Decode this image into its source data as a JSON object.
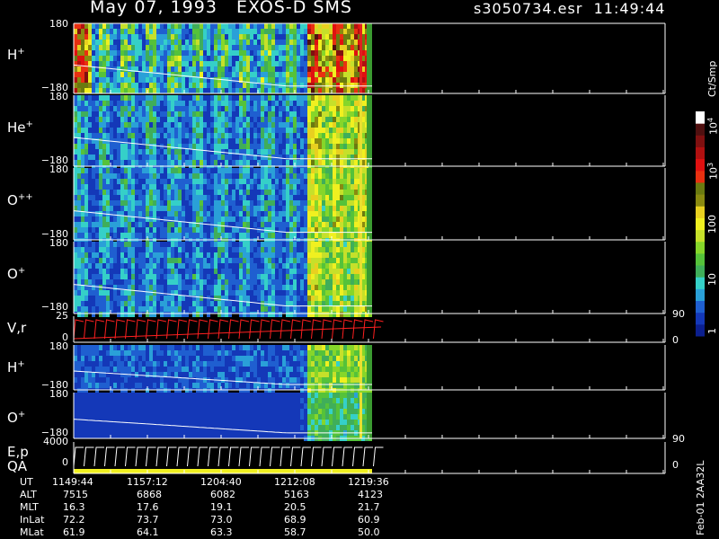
{
  "header": {
    "title": "May 07, 1993   EXOS-D SMS",
    "file_time": "s3050734.esr  11:49:44"
  },
  "chart_data": {
    "type": "heatmap",
    "panels": [
      {
        "label": "H",
        "sup": "+",
        "ymax": "180",
        "ymin": "−180"
      },
      {
        "label": "He",
        "sup": "+",
        "ymax": "180",
        "ymin": "−180"
      },
      {
        "label": "O",
        "sup": "++",
        "ymax": "180",
        "ymin": "−180"
      },
      {
        "label": "O",
        "sup": "+",
        "ymax": "180",
        "ymin": "−180"
      },
      {
        "label": "V,r",
        "sup": "",
        "ymax": "25",
        "ymin": "0",
        "rmax": "90",
        "rmin": "0"
      },
      {
        "label": "H",
        "sup": "+",
        "ymax": "180",
        "ymin": "−180"
      },
      {
        "label": "O",
        "sup": "+",
        "ymax": "180",
        "ymin": "−180",
        "rmin": "90"
      },
      {
        "label": "E,p",
        "label2": "QA",
        "ymax": "4000",
        "ymin": "0",
        "rmin": "0"
      }
    ],
    "colorbar": {
      "unit": "Ct/Smp",
      "ticks": [
        "1",
        "10",
        "100",
        "10",
        "10"
      ],
      "tick_sup": [
        "",
        "",
        "",
        "3",
        "4"
      ],
      "colors": [
        "#0b1f8f",
        "#1438b8",
        "#1f5fd0",
        "#2aa0d8",
        "#35d0c8",
        "#3fae5a",
        "#55c23a",
        "#86d62a",
        "#c6e02a",
        "#f0f020",
        "#e8d020",
        "#8a8a10",
        "#6a7a10",
        "#e83010",
        "#e01010",
        "#b01010",
        "#801010",
        "#501010",
        "#ffffff"
      ]
    },
    "time_axis": {
      "rows": [
        {
          "name": "UT",
          "values": [
            "1149:44",
            "1157:12",
            "1204:40",
            "1212:08",
            "1219:36"
          ]
        },
        {
          "name": "ALT",
          "values": [
            "7515",
            "6868",
            "6082",
            "5163",
            "4123"
          ]
        },
        {
          "name": "MLT",
          "values": [
            "16.3",
            "17.6",
            "19.1",
            "20.5",
            "21.7"
          ]
        },
        {
          "name": "InLat",
          "values": [
            "72.2",
            "73.7",
            "73.0",
            "68.9",
            "60.9"
          ]
        },
        {
          "name": "MLat",
          "values": [
            "61.9",
            "64.1",
            "63.3",
            "58.7",
            "50.0"
          ]
        }
      ]
    },
    "footer_note": "Feb-01 2AA32L"
  }
}
